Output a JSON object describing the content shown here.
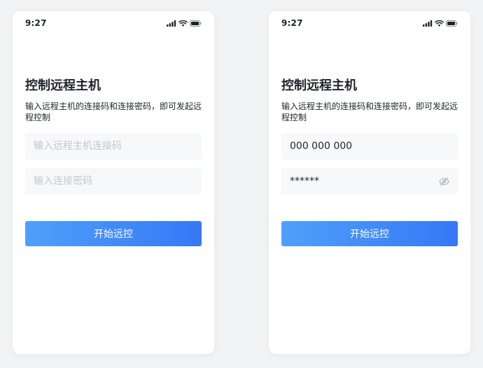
{
  "colors": {
    "background": "#f2f3f5",
    "card": "#ffffff",
    "text_primary": "#1f2329",
    "placeholder": "#c3c7cf",
    "input_bg": "#f7f8fa",
    "button_gradient_start": "#4fa0fa",
    "button_gradient_end": "#3578f6"
  },
  "screens": [
    {
      "status_bar": {
        "time": "9:27",
        "icons": [
          "signal-icon",
          "wifi-icon",
          "battery-icon"
        ]
      },
      "title": "控制远程主机",
      "description": "输入远程主机的连接码和连接密码，即可发起远程控制",
      "connection_code": {
        "value": "",
        "placeholder": "输入远程主机连接码"
      },
      "password": {
        "value": "",
        "placeholder": "输入连接密码"
      },
      "start_button_label": "开始远控"
    },
    {
      "status_bar": {
        "time": "9:27",
        "icons": [
          "signal-icon",
          "wifi-icon",
          "battery-icon"
        ]
      },
      "title": "控制远程主机",
      "description": "输入远程主机的连接码和连接密码，即可发起远程控制",
      "connection_code": {
        "value": "000 000 000",
        "placeholder": "输入远程主机连接码"
      },
      "password": {
        "value": "******",
        "placeholder": "输入连接密码",
        "toggle_icon": "eye-off-icon"
      },
      "start_button_label": "开始远控"
    }
  ]
}
